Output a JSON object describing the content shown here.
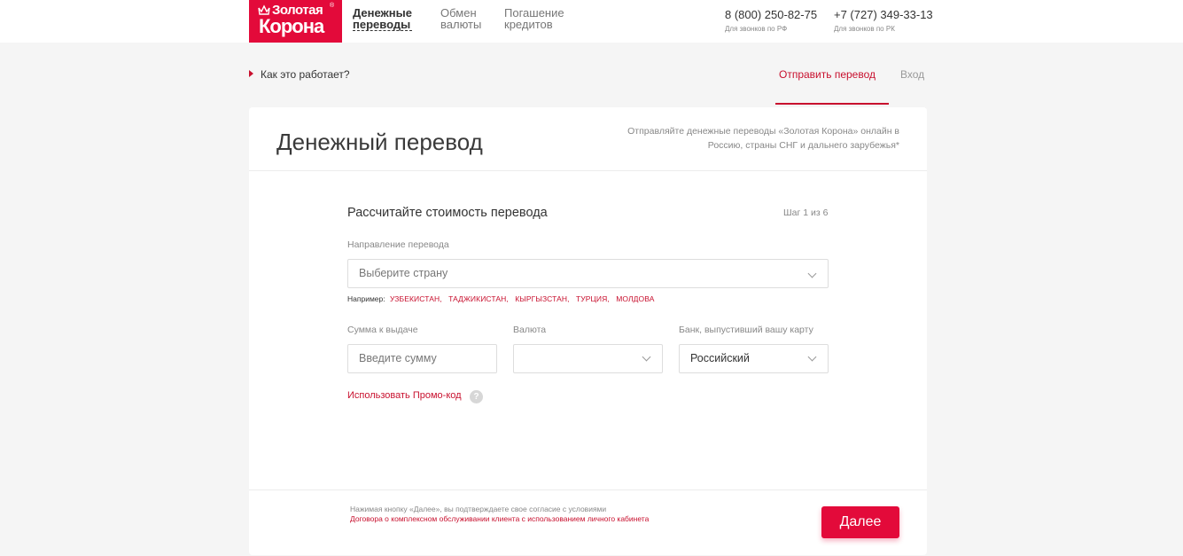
{
  "header": {
    "logo": {
      "line1": "Золотая",
      "line2": "Корона",
      "reg": "®"
    },
    "nav": [
      {
        "line1": "Денежные",
        "line2": "переводы",
        "active": true
      },
      {
        "line1": "Обмен",
        "line2": "валюты",
        "active": false
      },
      {
        "line1": "Погашение",
        "line2": "кредитов",
        "active": false
      }
    ],
    "phones": [
      {
        "number": "8 (800) 250-82-75",
        "note": "Для звонков по РФ"
      },
      {
        "number": "+7 (727) 349-33-13",
        "note": "Для звонков по РК"
      }
    ]
  },
  "subheader": {
    "how_it_works": "Как это работает?",
    "tab_send": "Отправить перевод",
    "tab_login": "Вход"
  },
  "card": {
    "title": "Денежный перевод",
    "description": "Отправляйте денежные переводы «Золотая Корона» онлайн в Россию, страны СНГ и дальнего зарубежья*",
    "calc_title": "Рассчитайте стоимость перевода",
    "step": "Шаг 1 из 6",
    "direction_label": "Направление перевода",
    "country_placeholder": "Выберите страну",
    "example_label": "Например:",
    "example_countries": [
      "УЗБЕКИСТАН,",
      "ТАДЖИКИСТАН,",
      "КЫРГЫЗСТАН,",
      "ТУРЦИЯ,",
      "МОЛДОВА"
    ],
    "sum_label": "Сумма к выдаче",
    "sum_placeholder": "Введите сумму",
    "currency_label": "Валюта",
    "currency_value": "",
    "bank_label": "Банк, выпустивший вашу карту",
    "bank_value": "Российский",
    "promo": "Использовать Промо-код",
    "help": "?",
    "agree_text": "Нажимая кнопку «Далее», вы подтверждаете свое согласие с условиями",
    "agree_link": "Договора о комплексном обслуживании клиента с использованием личного кабинета",
    "next_button": "Далее"
  },
  "colors": {
    "brand": "#e30a3a",
    "link": "#c8102e",
    "background": "#f5f5f5"
  }
}
